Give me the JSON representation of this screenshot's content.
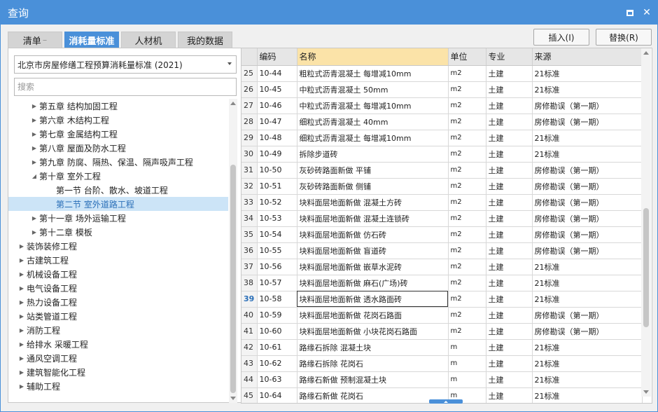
{
  "window": {
    "title": "查询",
    "maximize_icon": "maximize-icon",
    "close_icon": "close-icon",
    "close_glyph": "✕"
  },
  "tabs": [
    {
      "label": "清单",
      "suffix": "–"
    },
    {
      "label": "消耗量标准",
      "suffix": ""
    },
    {
      "label": "人材机",
      "suffix": ""
    },
    {
      "label": "我的数据",
      "suffix": ""
    }
  ],
  "buttons": {
    "insert": "插入(I)",
    "replace": "替换(R)"
  },
  "left": {
    "standard_select": "北京市房屋修缮工程预算消耗量标准 (2021)",
    "search_placeholder": "搜索",
    "tree": [
      {
        "label": "第五章 结构加固工程",
        "level": 1,
        "state": "collapsed"
      },
      {
        "label": "第六章 木结构工程",
        "level": 1,
        "state": "collapsed"
      },
      {
        "label": "第七章 金属结构工程",
        "level": 1,
        "state": "collapsed"
      },
      {
        "label": "第八章 屋面及防水工程",
        "level": 1,
        "state": "collapsed"
      },
      {
        "label": "第九章 防腐、隔热、保温、隔声吸声工程",
        "level": 1,
        "state": "collapsed"
      },
      {
        "label": "第十章 室外工程",
        "level": 1,
        "state": "expanded"
      },
      {
        "label": "第一节 台阶、散水、坡道工程",
        "level": 2,
        "state": "leaf"
      },
      {
        "label": "第二节 室外道路工程",
        "level": 2,
        "state": "leaf",
        "selected": true
      },
      {
        "label": "第十一章 场外运输工程",
        "level": 1,
        "state": "collapsed"
      },
      {
        "label": "第十二章 模板",
        "level": 1,
        "state": "collapsed"
      },
      {
        "label": "装饰装修工程",
        "level": 0,
        "state": "collapsed"
      },
      {
        "label": "古建筑工程",
        "level": 0,
        "state": "collapsed"
      },
      {
        "label": "机械设备工程",
        "level": 0,
        "state": "collapsed"
      },
      {
        "label": "电气设备工程",
        "level": 0,
        "state": "collapsed"
      },
      {
        "label": "热力设备工程",
        "level": 0,
        "state": "collapsed"
      },
      {
        "label": "站类管道工程",
        "level": 0,
        "state": "collapsed"
      },
      {
        "label": "消防工程",
        "level": 0,
        "state": "collapsed"
      },
      {
        "label": "给排水 采暖工程",
        "level": 0,
        "state": "collapsed"
      },
      {
        "label": "通风空调工程",
        "level": 0,
        "state": "collapsed"
      },
      {
        "label": "建筑智能化工程",
        "level": 0,
        "state": "collapsed"
      },
      {
        "label": "辅助工程",
        "level": 0,
        "state": "collapsed"
      }
    ]
  },
  "grid": {
    "columns": [
      "",
      "编码",
      "名称",
      "单位",
      "专业",
      "来源"
    ],
    "current_row": "39",
    "rows": [
      [
        "25",
        "10-44",
        "粗粒式沥青混凝土 每增减10mm",
        "m2",
        "土建",
        "21标准"
      ],
      [
        "26",
        "10-45",
        "中粒式沥青混凝土 50mm",
        "m2",
        "土建",
        "21标准"
      ],
      [
        "27",
        "10-46",
        "中粒式沥青混凝土 每增减10mm",
        "m2",
        "土建",
        "房修勘误（第一期）"
      ],
      [
        "28",
        "10-47",
        "细粒式沥青混凝土 40mm",
        "m2",
        "土建",
        "房修勘误（第一期）"
      ],
      [
        "29",
        "10-48",
        "细粒式沥青混凝土 每增减10mm",
        "m2",
        "土建",
        "21标准"
      ],
      [
        "30",
        "10-49",
        "拆除步道砖",
        "m2",
        "土建",
        "21标准"
      ],
      [
        "31",
        "10-50",
        "灰砂砖路面新做 平铺",
        "m2",
        "土建",
        "房修勘误（第一期）"
      ],
      [
        "32",
        "10-51",
        "灰砂砖路面新做 侧铺",
        "m2",
        "土建",
        "房修勘误（第一期）"
      ],
      [
        "33",
        "10-52",
        "块料面层地面新做 混凝土方砖",
        "m2",
        "土建",
        "房修勘误（第一期）"
      ],
      [
        "34",
        "10-53",
        "块料面层地面新做 混凝土连锁砖",
        "m2",
        "土建",
        "房修勘误（第一期）"
      ],
      [
        "35",
        "10-54",
        "块料面层地面新做 仿石砖",
        "m2",
        "土建",
        "房修勘误（第一期）"
      ],
      [
        "36",
        "10-55",
        "块料面层地面新做 盲道砖",
        "m2",
        "土建",
        "房修勘误（第一期）"
      ],
      [
        "37",
        "10-56",
        "块料面层地面新做 嵌草水泥砖",
        "m2",
        "土建",
        "21标准"
      ],
      [
        "38",
        "10-57",
        "块料面层地面新做 麻石(广场)砖",
        "m2",
        "土建",
        "21标准"
      ],
      [
        "39",
        "10-58",
        "块料面层地面新做 透水路面砖",
        "m2",
        "土建",
        "21标准"
      ],
      [
        "40",
        "10-59",
        "块料面层地面新做 花岗石路面",
        "m2",
        "土建",
        "房修勘误（第一期）"
      ],
      [
        "41",
        "10-60",
        "块料面层地面新做 小块花岗石路面",
        "m2",
        "土建",
        "房修勘误（第一期）"
      ],
      [
        "42",
        "10-61",
        "路缘石拆除 混凝土块",
        "m",
        "土建",
        "21标准"
      ],
      [
        "43",
        "10-62",
        "路缘石拆除 花岗石",
        "m",
        "土建",
        "21标准"
      ],
      [
        "44",
        "10-63",
        "路缘石新做 预制混凝土块",
        "m",
        "土建",
        "21标准"
      ],
      [
        "45",
        "10-64",
        "路缘石新做 花岗石",
        "m",
        "土建",
        "21标准"
      ]
    ]
  }
}
